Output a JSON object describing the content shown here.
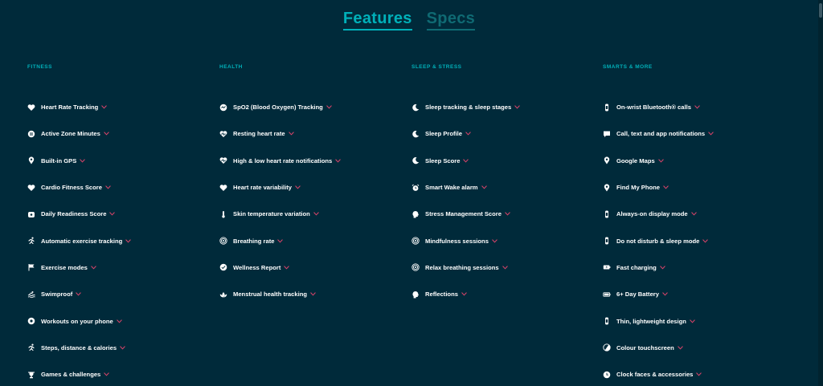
{
  "tabs": [
    {
      "label": "Features",
      "active": true
    },
    {
      "label": "Specs",
      "active": false
    }
  ],
  "colors": {
    "background": "#002a3a",
    "accent": "#00b0b9",
    "chevron": "#e0446b"
  },
  "columns": [
    {
      "heading": "FITNESS",
      "items": [
        {
          "label": "Heart Rate Tracking",
          "icon": "heart-icon"
        },
        {
          "label": "Active Zone Minutes",
          "icon": "zone-minutes-icon"
        },
        {
          "label": "Built-in GPS",
          "icon": "location-pin-icon"
        },
        {
          "label": "Cardio Fitness Score",
          "icon": "heart-icon"
        },
        {
          "label": "Daily Readiness Score",
          "icon": "gauge-icon"
        },
        {
          "label": "Automatic exercise tracking",
          "icon": "running-icon"
        },
        {
          "label": "Exercise modes",
          "icon": "flag-icon"
        },
        {
          "label": "Swimproof",
          "icon": "swim-icon"
        },
        {
          "label": "Workouts on your phone",
          "icon": "phone-workout-icon"
        },
        {
          "label": "Steps, distance & calories",
          "icon": "running-icon"
        },
        {
          "label": "Games & challenges",
          "icon": "trophy-icon"
        }
      ]
    },
    {
      "heading": "HEALTH",
      "items": [
        {
          "label": "SpO2 (Blood Oxygen) Tracking",
          "icon": "spo2-icon"
        },
        {
          "label": "Resting heart rate",
          "icon": "heart-pulse-icon"
        },
        {
          "label": "High & low heart rate notifications",
          "icon": "heart-pulse-icon"
        },
        {
          "label": "Heart rate variability",
          "icon": "heart-icon"
        },
        {
          "label": "Skin temperature variation",
          "icon": "thermometer-icon"
        },
        {
          "label": "Breathing rate",
          "icon": "breathing-icon"
        },
        {
          "label": "Wellness Report",
          "icon": "report-icon"
        },
        {
          "label": "Menstrual health tracking",
          "icon": "lotus-icon"
        }
      ]
    },
    {
      "heading": "SLEEP & STRESS",
      "items": [
        {
          "label": "Sleep tracking & sleep stages",
          "icon": "moon-icon"
        },
        {
          "label": "Sleep Profile",
          "icon": "moon-icon"
        },
        {
          "label": "Sleep Score",
          "icon": "moon-icon"
        },
        {
          "label": "Smart Wake alarm",
          "icon": "alarm-icon"
        },
        {
          "label": "Stress Management Score",
          "icon": "head-icon"
        },
        {
          "label": "Mindfulness sessions",
          "icon": "breathing-icon"
        },
        {
          "label": "Relax breathing sessions",
          "icon": "breathing-icon"
        },
        {
          "label": "Reflections",
          "icon": "head-icon"
        }
      ]
    },
    {
      "heading": "SMARTS & MORE",
      "items": [
        {
          "label": "On-wrist Bluetooth® calls",
          "icon": "watch-icon"
        },
        {
          "label": "Call, text and app notifications",
          "icon": "chat-icon"
        },
        {
          "label": "Google Maps",
          "icon": "location-pin-icon"
        },
        {
          "label": "Find My Phone",
          "icon": "location-pin-icon"
        },
        {
          "label": "Always-on display mode",
          "icon": "watch-icon"
        },
        {
          "label": "Do not disturb & sleep mode",
          "icon": "watch-icon"
        },
        {
          "label": "Fast charging",
          "icon": "charging-icon"
        },
        {
          "label": "6+ Day Battery",
          "icon": "battery-icon"
        },
        {
          "label": "Thin, lightweight design",
          "icon": "watch-icon"
        },
        {
          "label": "Colour touchscreen",
          "icon": "color-wheel-icon"
        },
        {
          "label": "Clock faces & accessories",
          "icon": "clock-face-icon"
        }
      ]
    }
  ]
}
